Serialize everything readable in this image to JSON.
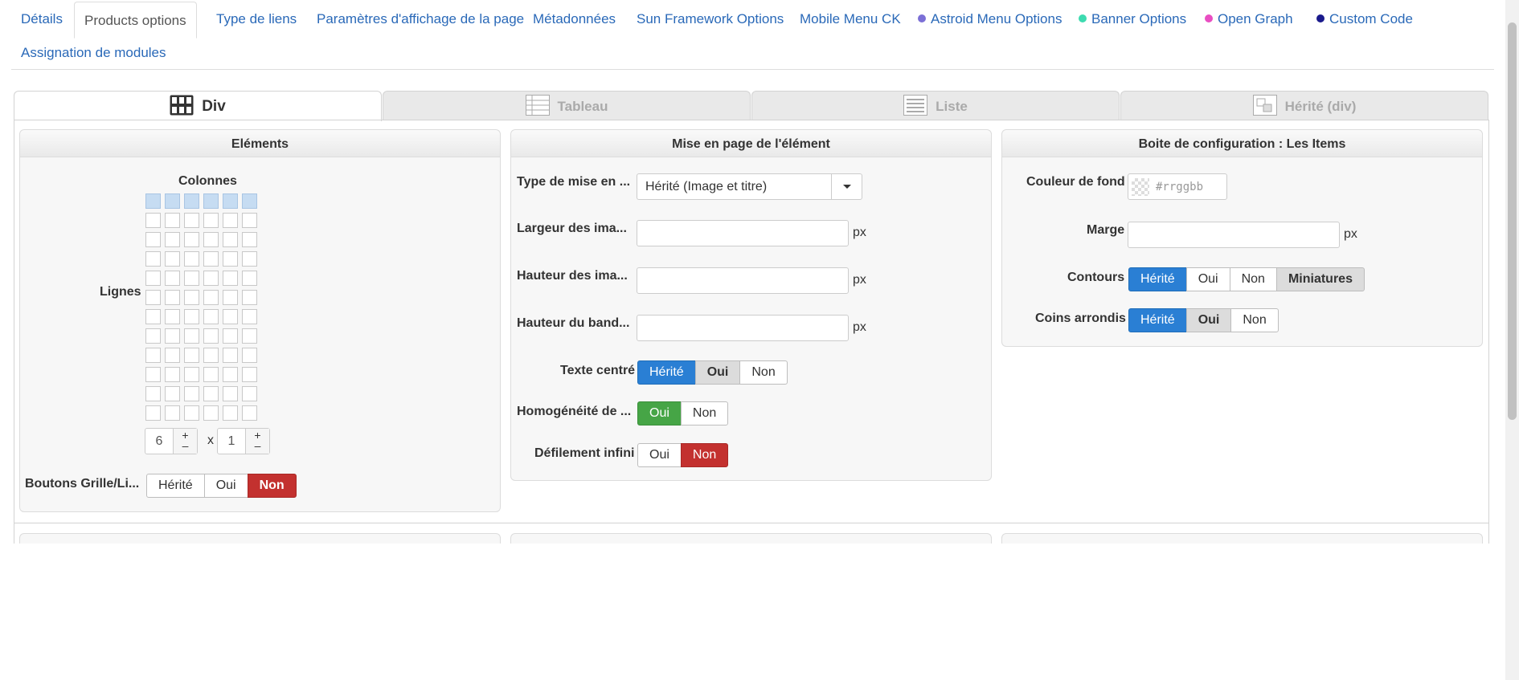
{
  "nav_tabs": [
    {
      "label": "Détails"
    },
    {
      "label": "Products options",
      "active": true
    },
    {
      "label": "Type de liens"
    },
    {
      "label": "Paramètres d'affichage de la page"
    },
    {
      "label": "Métadonnées"
    },
    {
      "label": "Sun Framework Options"
    },
    {
      "label": "Mobile Menu CK"
    },
    {
      "label": "Astroid Menu Options",
      "dot_color": "#7b6fd6"
    },
    {
      "label": "Banner Options",
      "dot_color": "#3ddbb0"
    },
    {
      "label": "Open Graph",
      "dot_color": "#e94ec2"
    },
    {
      "label": "Custom Code",
      "dot_color": "#1a1a8c"
    },
    {
      "label": "Assignation de modules"
    }
  ],
  "layout_tabs": [
    {
      "label": "Div",
      "icon": "grid-layout-icon",
      "active": true
    },
    {
      "label": "Tableau",
      "icon": "table-layout-icon"
    },
    {
      "label": "Liste",
      "icon": "list-layout-icon"
    },
    {
      "label": "Hérité (div)",
      "icon": "inherited-layout-icon"
    }
  ],
  "elements_panel": {
    "title": "Eléments",
    "columns_label": "Colonnes",
    "rows_label": "Lignes",
    "columns_value": "6",
    "rows_value": "1",
    "times_label": "x",
    "plus": "+",
    "minus": "–",
    "grid_buttons_label": "Boutons Grille/Li...",
    "grid_buttons": [
      "Hérité",
      "Oui",
      "Non"
    ]
  },
  "layout_panel": {
    "title": "Mise en page de l'élément",
    "type_label": "Type de mise en ...",
    "type_value": "Hérité (Image et titre)",
    "image_width_label": "Largeur des ima...",
    "image_height_label": "Hauteur des ima...",
    "banner_height_label": "Hauteur du band...",
    "unit": "px",
    "centered_text_label": "Texte centré",
    "centered_text_options": [
      "Hérité",
      "Oui",
      "Non"
    ],
    "homogeneity_label": "Homogénéité de ...",
    "homogeneity_options": [
      "Oui",
      "Non"
    ],
    "infinite_scroll_label": "Défilement infini",
    "infinite_scroll_options": [
      "Oui",
      "Non"
    ]
  },
  "config_panel": {
    "title": "Boite de configuration : Les Items",
    "bg_color_label": "Couleur de fond",
    "bg_color_placeholder": "#rrggbb",
    "margin_label": "Marge",
    "unit": "px",
    "borders_label": "Contours",
    "borders_options": [
      "Hérité",
      "Oui",
      "Non",
      "Miniatures"
    ],
    "rounded_label": "Coins arrondis",
    "rounded_options": [
      "Hérité",
      "Oui",
      "Non"
    ]
  },
  "colors": {
    "link": "#2a69b8",
    "active_blue": "#2a7fd4",
    "active_red": "#c3312f",
    "active_green": "#46a546",
    "grid_selected": "#c6dcf2"
  }
}
